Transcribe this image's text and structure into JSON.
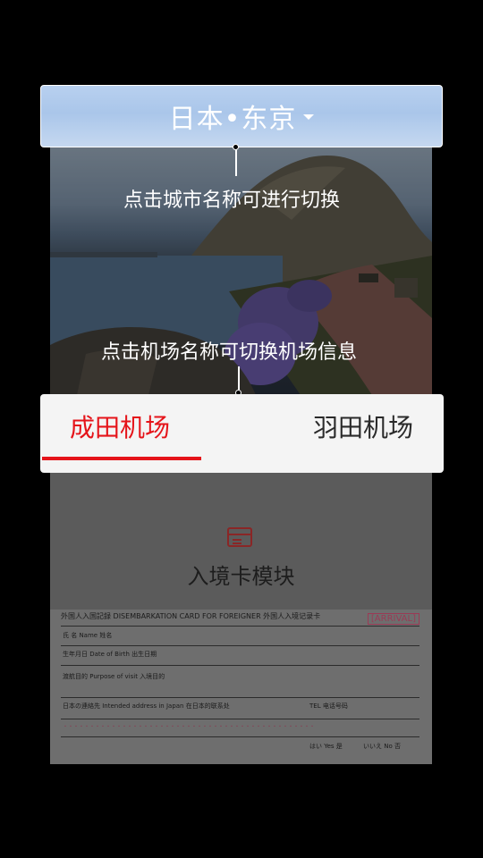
{
  "city_selector": {
    "label": "日本•东京",
    "icon": "caret-down-icon"
  },
  "hints": {
    "city_hint": "点击城市名称可进行切换",
    "airport_hint": "点击机场名称可切换机场信息"
  },
  "airport_tabs": [
    {
      "label": "成田机场",
      "active": true
    },
    {
      "label": "羽田机场",
      "active": false
    }
  ],
  "module": {
    "icon": "card-icon",
    "title": "入境卡模块"
  },
  "form_preview": {
    "header": "外国人入国記録  DISEMBARKATION CARD FOR FOREIGNER  外国人入境记录卡",
    "badge": "[ARRIVAL]",
    "field_name": "氏 名 Name 姓名",
    "field_birth": "生年月日 Date of Birth 出生日期",
    "field_purpose": "渡航目的 Purpose of visit 入境目的",
    "field_address": "日本の連絡先 Intended address in Japan 在日本的联系处",
    "field_tel": "TEL 电话号码",
    "options": [
      "はい Yes 是",
      "いいえ No 否"
    ]
  },
  "colors": {
    "accent": "#e5141a",
    "tab_background": "#f4f4f4",
    "city_bar": "#b8d0ef"
  }
}
